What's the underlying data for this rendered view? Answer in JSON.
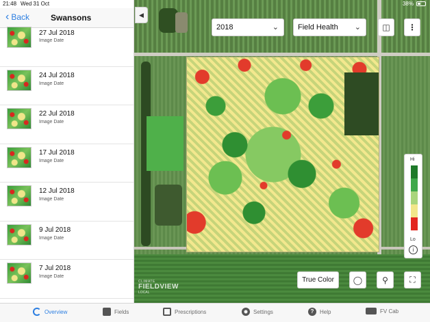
{
  "status": {
    "time": "21:48",
    "date": "Wed 31 Oct",
    "battery": "38%"
  },
  "nav": {
    "back_label": "Back",
    "title": "Swansons"
  },
  "images": [
    {
      "date": "27 Jul 2018",
      "caption": "Image Date"
    },
    {
      "date": "24 Jul 2018",
      "caption": "Image Date"
    },
    {
      "date": "22 Jul 2018",
      "caption": "Image Date"
    },
    {
      "date": "17 Jul 2018",
      "caption": "Image Date"
    },
    {
      "date": "12 Jul 2018",
      "caption": "Image Date"
    },
    {
      "date": "9 Jul 2018",
      "caption": "Image Date"
    },
    {
      "date": "7 Jul 2018",
      "caption": "Image Date"
    }
  ],
  "map": {
    "year_select": "2018",
    "layer_select": "Field Health",
    "true_color_label": "True Color",
    "legend": {
      "hi": "Hi",
      "lo": "Lo",
      "colors": [
        "#1f7a2a",
        "#3fa84a",
        "#a9d57c",
        "#f2e68a",
        "#f5a23a",
        "#e3261f"
      ]
    },
    "watermark": {
      "top": "CLIMATE",
      "main": "FIELDVIEW",
      "bottom": "LOCAL"
    }
  },
  "tabs": [
    {
      "label": "Overview",
      "icon": "overview-icon",
      "active": true
    },
    {
      "label": "Fields",
      "icon": "fields-icon",
      "active": false
    },
    {
      "label": "Prescriptions",
      "icon": "prescriptions-icon",
      "active": false
    },
    {
      "label": "Settings",
      "icon": "settings-icon",
      "active": false
    },
    {
      "label": "Help",
      "icon": "help-icon",
      "active": false
    },
    {
      "label": "FV Cab",
      "icon": "fv-cab-icon",
      "active": false
    }
  ],
  "colors": {
    "accent": "#2a7de1"
  }
}
